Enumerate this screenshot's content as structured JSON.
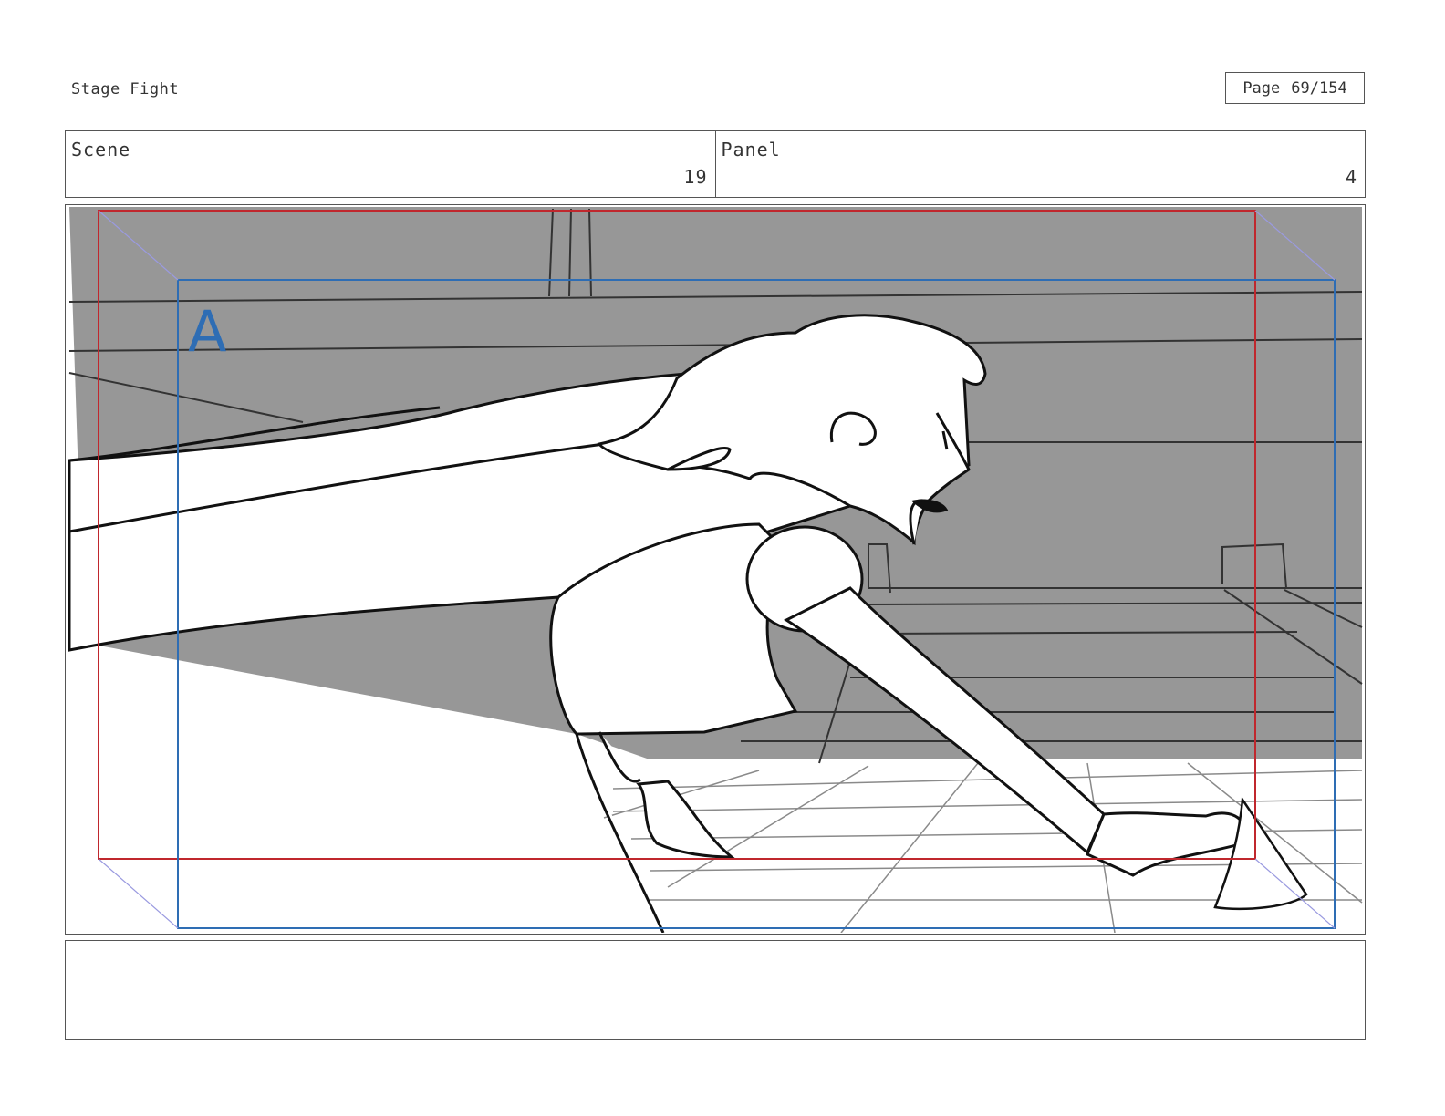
{
  "header": {
    "title": "Stage Fight",
    "page_label": "Page",
    "page_number": "69/154"
  },
  "scene": {
    "label": "Scene",
    "value": "19"
  },
  "panel": {
    "label": "Panel",
    "value": "4"
  },
  "frame": {
    "marker_label": "A",
    "colors": {
      "background": "#979797",
      "red_frame": "#c0272d",
      "blue_frame": "#2e6db4",
      "ink": "#111111"
    }
  },
  "notes": {
    "text": ""
  }
}
